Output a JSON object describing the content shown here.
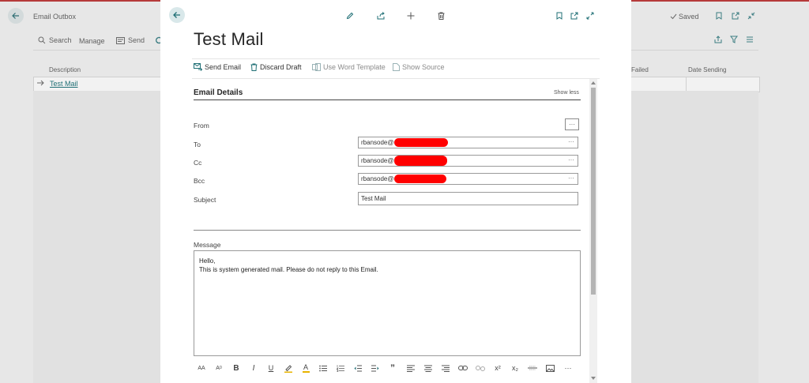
{
  "background": {
    "title": "Email Outbox",
    "toolbar": {
      "search": "Search",
      "manage": "Manage",
      "send": "Send"
    },
    "columns": {
      "description": "Description",
      "failed": "Failed",
      "date_sending": "Date Sending"
    },
    "row_description": "Test Mail",
    "status": "Saved"
  },
  "dialog": {
    "title": "Test Mail",
    "actions": {
      "send_email": "Send Email",
      "discard_draft": "Discard Draft",
      "use_word_template": "Use Word Template",
      "show_source": "Show Source"
    },
    "section": {
      "title": "Email Details",
      "toggle": "Show less"
    },
    "fields": {
      "from_label": "From",
      "to_label": "To",
      "to_value": "rbansode@",
      "cc_label": "Cc",
      "cc_value": "rbansode@",
      "bcc_label": "Bcc",
      "bcc_value": "rbansode@",
      "subject_label": "Subject",
      "subject_value": "Test Mail",
      "more": "···"
    },
    "message": {
      "label": "Message",
      "line1": "Hello,",
      "line2": "This is system generated mail. Please do not reply to this Email."
    },
    "editor_toolbar": {
      "font_size": "AA",
      "superscript_a": "A",
      "bold": "B",
      "italic": "I",
      "underline": "U",
      "font_color": "A",
      "quote": "”",
      "superscript": "x²",
      "subscript": "x₂",
      "more": "···"
    }
  },
  "colors": {
    "accent": "#1f6f75",
    "redaction": "#ff0000",
    "back_button_bg": "#d9e8ea"
  }
}
